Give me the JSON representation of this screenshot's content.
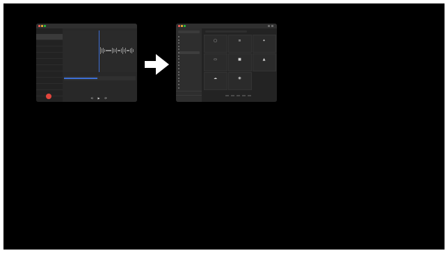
{
  "colors": {
    "stage_bg": "#000000",
    "window_bg": "#262626",
    "accent_blue": "#3d6fd6",
    "record_red": "#e2453c",
    "arrow_white": "#ffffff",
    "traffic_red": "#ff5f57",
    "traffic_yellow": "#febc2e",
    "traffic_green": "#28c840"
  },
  "voice_memos": {
    "title": "",
    "recordings": [
      {
        "name": "",
        "duration": ""
      },
      {
        "name": "",
        "duration": ""
      },
      {
        "name": "",
        "duration": ""
      },
      {
        "name": "",
        "duration": ""
      },
      {
        "name": "",
        "duration": ""
      },
      {
        "name": "",
        "duration": ""
      },
      {
        "name": "",
        "duration": ""
      },
      {
        "name": "",
        "duration": ""
      },
      {
        "name": "",
        "duration": ""
      },
      {
        "name": "",
        "duration": ""
      },
      {
        "name": "",
        "duration": ""
      }
    ],
    "timecode": "",
    "icons": {
      "record": "record-icon",
      "rewind": "skip-back-icon",
      "play": "play-icon",
      "forward": "skip-forward-icon"
    },
    "progress": 0.47
  },
  "transition_arrow": {
    "icon": "arrow-right-icon"
  },
  "settings": {
    "search_placeholder": "",
    "sidebar": [
      {
        "label": ""
      },
      {
        "label": ""
      },
      {
        "label": ""
      },
      {
        "label": ""
      },
      {
        "label": ""
      },
      {
        "label": ""
      },
      {
        "label": ""
      },
      {
        "label": ""
      },
      {
        "label": ""
      },
      {
        "label": ""
      },
      {
        "label": ""
      },
      {
        "label": ""
      },
      {
        "label": ""
      },
      {
        "label": ""
      },
      {
        "label": ""
      },
      {
        "label": ""
      },
      {
        "label": ""
      }
    ],
    "footer": [
      {
        "label": "",
        "value": ""
      },
      {
        "label": "",
        "value": ""
      }
    ],
    "cards": [
      {
        "label": "",
        "icon": "box-icon"
      },
      {
        "label": "",
        "icon": "sliders-icon"
      },
      {
        "label": "",
        "icon": "gear-icon"
      },
      {
        "label": "",
        "icon": "window-icon"
      },
      {
        "label": "",
        "icon": "display-icon"
      },
      {
        "label": "",
        "icon": "network-icon"
      },
      {
        "label": "",
        "icon": "cloud-icon"
      },
      {
        "label": "",
        "icon": "shield-icon"
      }
    ],
    "badge": ""
  }
}
